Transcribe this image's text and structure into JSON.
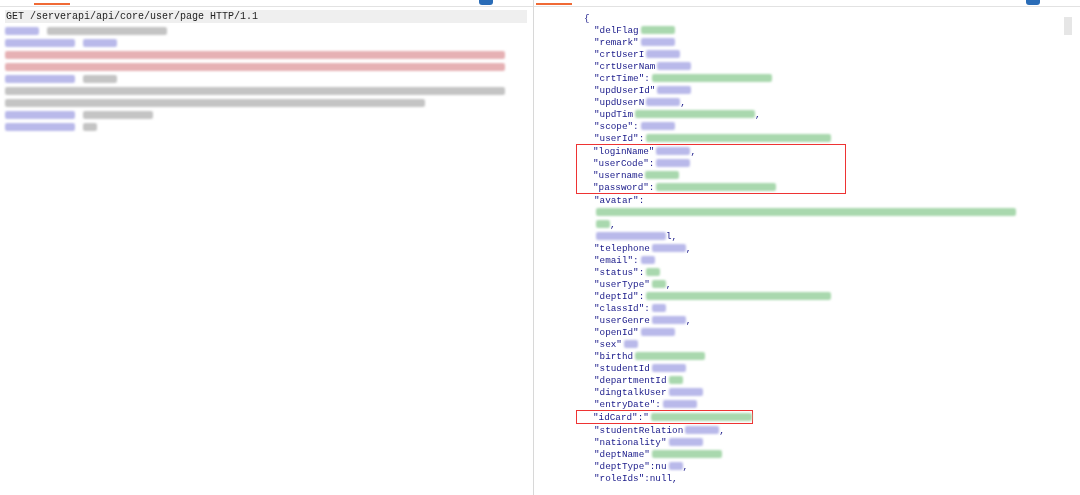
{
  "request": {
    "first_line": "GET /serverapi/api/core/user/page HTTP/1.1",
    "lines": [
      {
        "segments": [
          {
            "color": "#b9b9ea"
          },
          {
            "color": "#c4c4c4"
          }
        ]
      },
      {
        "segments": [
          {
            "color": "#b9b9ea"
          },
          {
            "color": "#b9b9ea"
          }
        ]
      },
      {
        "segments": [
          {
            "color": "#e6b1b4"
          }
        ]
      },
      {
        "segments": [
          {
            "color": "#e6b1b4"
          }
        ]
      },
      {
        "segments": [
          {
            "color": "#b9b9ea"
          },
          {
            "color": "#c4c4c4"
          }
        ]
      },
      {
        "segments": [
          {
            "color": "#c4c4c4"
          }
        ]
      },
      {
        "segments": [
          {
            "color": "#c4c4c4"
          }
        ]
      },
      {
        "segments": [
          {
            "color": "#b9b9ea"
          },
          {
            "color": "#c4c4c4"
          }
        ]
      },
      {
        "segments": [
          {
            "color": "#b9b9ea"
          },
          {
            "color": "#c4c4c4"
          }
        ]
      }
    ]
  },
  "response": {
    "blocks": [
      {
        "kind": "plain",
        "lines": [
          {
            "key": "{"
          },
          {
            "key": "\"delFlag",
            "color": "#a9d8ae"
          },
          {
            "key": "\"remark\"",
            "color": "#b9b9ea"
          },
          {
            "key": "\"crtUserI",
            "color": "#b9b9ea"
          },
          {
            "key": "\"crtUserNam",
            "color": "#b9b9ea"
          },
          {
            "key": "\"crtTime\":",
            "color": "#a9d8ae"
          },
          {
            "key": "\"updUserId\"",
            "color": "#b9b9ea"
          },
          {
            "key": "\"updUserN",
            "color": "#b9b9ea",
            "suffix": ","
          },
          {
            "key": "\"updTim",
            "color": "#a9d8ae",
            "suffix": ","
          },
          {
            "key": "\"scope\":",
            "color": "#b9b9ea"
          },
          {
            "key": "\"userId\":",
            "color": "#a9d8ae"
          }
        ]
      },
      {
        "kind": "boxed",
        "lines": [
          {
            "key": "\"loginName\"",
            "color": "#b9b9ea",
            "suffix": ","
          },
          {
            "key": "\"userCode\":",
            "color": "#b9b9ea"
          },
          {
            "key": "\"username",
            "color": "#a9d8ae"
          },
          {
            "key": "\"password\":",
            "color": "#a9d8ae"
          }
        ]
      },
      {
        "kind": "plain",
        "lines": [
          {
            "key": "\"avatar\":"
          },
          {
            "color": "#a9d8ae"
          },
          {
            "color": "#a9d8ae",
            "suffix": ","
          },
          {
            "color": "#b9b9ea",
            "suffix": "l,"
          },
          {
            "key": "\"telephone",
            "color": "#b9b9ea",
            "suffix": ","
          },
          {
            "key": "\"email\":",
            "color": "#b9b9ea"
          },
          {
            "key": "\"status\":",
            "color": "#a9d8ae"
          },
          {
            "key": "\"userType\"",
            "color": "#a9d8ae",
            "suffix": ","
          },
          {
            "key": "\"deptId\":",
            "color": "#a9d8ae"
          },
          {
            "key": "\"classId\":",
            "color": "#b9b9ea"
          },
          {
            "key": "\"userGenre",
            "color": "#b9b9ea",
            "suffix": ","
          },
          {
            "key": "\"openId\"",
            "color": "#b9b9ea"
          },
          {
            "key": "\"sex\"",
            "color": "#b9b9ea"
          },
          {
            "key": "\"birthd",
            "color": "#a9d8ae"
          },
          {
            "key": "\"studentId",
            "color": "#b9b9ea"
          },
          {
            "key": "\"departmentId",
            "color": "#a9d8ae"
          },
          {
            "key": "\"dingtalkUser",
            "color": "#b9b9ea"
          },
          {
            "key": "\"entryDate\":",
            "color": "#b9b9ea"
          }
        ]
      },
      {
        "kind": "boxed",
        "lines": [
          {
            "key": "\"idCard\":\"",
            "color": "#a9d8ae"
          }
        ]
      },
      {
        "kind": "plain",
        "lines": [
          {
            "key": "\"studentRelation",
            "color": "#b9b9ea",
            "suffix": ","
          },
          {
            "key": "\"nationality\"",
            "color": "#b9b9ea"
          },
          {
            "key": "\"deptName\"",
            "color": "#a9d8ae"
          },
          {
            "key": "\"deptType\":nu",
            "color": "#b9b9ea",
            "suffix": ","
          },
          {
            "key": "\"roleIds\":null,"
          }
        ]
      }
    ]
  }
}
